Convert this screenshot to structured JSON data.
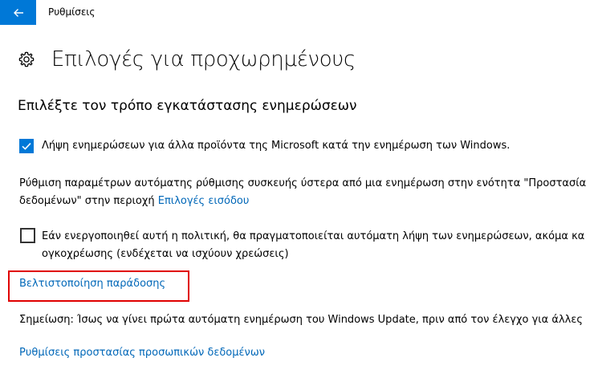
{
  "titlebar": {
    "app_title": "Ρυθμίσεις",
    "back_icon": "arrow-left-icon",
    "accent": "#0078d7"
  },
  "header": {
    "icon": "gear-icon",
    "title": "Επιλογές για προχωρημένους"
  },
  "section": {
    "title": "Επιλέξτε τον τρόπο εγκατάστασης ενημερώσεων"
  },
  "options": {
    "other_products": {
      "checked": true,
      "label": "Λήψη ενημερώσεων για άλλα προϊόντα της Microsoft κατά την ενημέρωση των Windows."
    },
    "signin_info": {
      "line1": "Ρύθμιση παραμέτρων αυτόματης ρύθμισης συσκευής ύστερα από μια ενημέρωση στην ενότητα \"Προστασία",
      "line2_prefix": "δεδομένων\" στην περιοχή ",
      "line2_link": "Επιλογές εισόδου"
    },
    "metered": {
      "checked": false,
      "line1": "Εάν ενεργοποιηθεί αυτή η πολιτική, θα πραγματοποιείται αυτόματη λήψη των ενημερώσεων, ακόμα κα",
      "line2": "ογκοχρέωσης (ενδέχεται να ισχύουν χρεώσεις)"
    }
  },
  "links": {
    "delivery_optimization": "Βελτιστοποίηση παράδοσης",
    "privacy_settings": "Ρυθμίσεις προστασίας προσωπικών δεδομένων"
  },
  "note": "Σημείωση: Ίσως να γίνει πρώτα αυτόματη ενημέρωση του Windows Update, πριν από τον έλεγχο για άλλες",
  "colors": {
    "link": "#0067b8",
    "highlight": "#e00000"
  }
}
